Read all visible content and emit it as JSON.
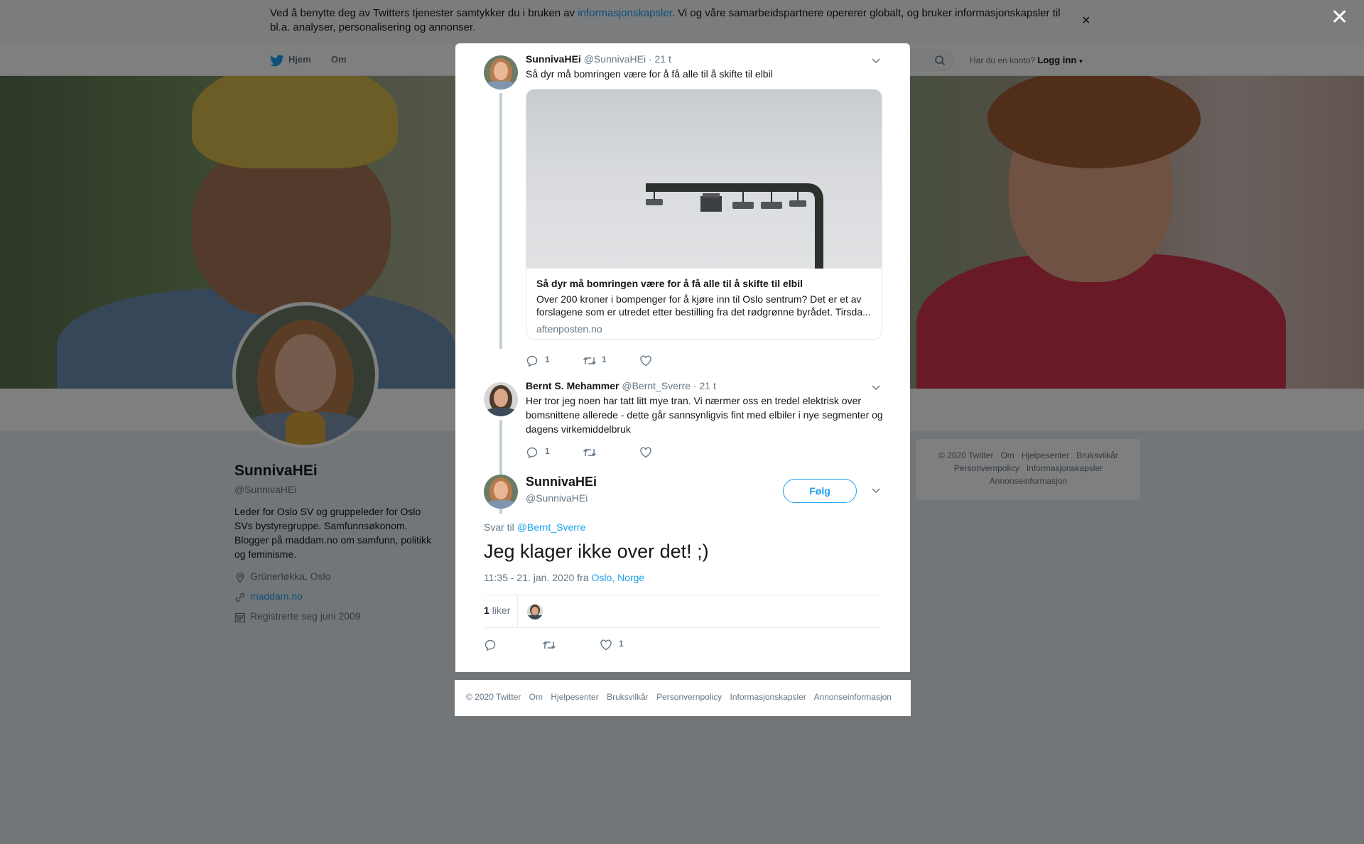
{
  "cookie_banner": {
    "text_before": "Ved å benytte deg av Twitters tjenester samtykker du i bruken av ",
    "link": "informasjonskapsler",
    "text_after": ". Vi og våre samarbeidspartnere opererer globalt, og bruker informasjonskapsler til bl.a. analyser, personalisering og annonser.",
    "close": "×"
  },
  "nav": {
    "home": "Hjem",
    "about": "Om",
    "account_prompt": "Har du en konto?",
    "login": "Logg inn"
  },
  "profile": {
    "name": "SunnivaHEi",
    "handle": "@SunnivaHEi",
    "bio": "Leder for Oslo SV og gruppeleder for Oslo SVs bystyregruppe. Samfunnsøkonom. Blogger på maddam.no om samfunn, politikk og feminisme.",
    "location": "Grünerløkka, Oslo",
    "website": "maddam.no",
    "joined": "Registrerte seg juni 2009"
  },
  "side_footer": [
    "© 2020 Twitter",
    "Om",
    "Hjelpesenter",
    "Bruksvilkår",
    "Personvernpolicy",
    "Informasjonskapsler",
    "Annonseinformasjon"
  ],
  "overlay_close": "×",
  "thread": {
    "tweet1": {
      "name": "SunnivaHEi",
      "handle": "@SunnivaHEi",
      "time": "· 21 t",
      "text": "Så dyr må bomringen være for å få alle til å skifte til elbil",
      "card": {
        "title": "Så dyr må bomringen være for å få alle til å skifte til elbil",
        "description": "Over 200 kroner i bompenger for å kjøre inn til Oslo sentrum? Det er et av forslagene som er utredet etter bestilling fra det rødgrønne byrådet. Tirsda...",
        "domain": "aftenposten.no"
      },
      "replies": "1",
      "retweets": "1"
    },
    "tweet2": {
      "name": "Bernt S. Mehammer",
      "handle": "@Bernt_Sverre",
      "time": "· 21 t",
      "text": "Her tror jeg noen har tatt litt mye tran. Vi nærmer oss en tredel elektrisk over bomsnittene allerede - dette går sannsynligvis fint med elbiler i nye segmenter og dagens virkemiddelbruk",
      "replies": "1"
    },
    "main": {
      "name": "SunnivaHEi",
      "handle": "@SunnivaHEi",
      "follow": "Følg",
      "reply_prefix": "Svar til ",
      "reply_to": "@Bernt_Sverre",
      "text": "Jeg klager ikke over det! ;)",
      "time": "11:35 - 21. jan. 2020 fra ",
      "place": "Oslo, Norge",
      "likes_count": "1",
      "likes_label": "liker",
      "like_action_count": "1"
    }
  },
  "modal_footer": [
    "© 2020 Twitter",
    "Om",
    "Hjelpesenter",
    "Bruksvilkår",
    "Personvernpolicy",
    "Informasjonskapsler",
    "Annonseinformasjon"
  ],
  "colors": {
    "accent": "#1da1f2",
    "overlay": "rgba(0,0,0,0.5)"
  }
}
